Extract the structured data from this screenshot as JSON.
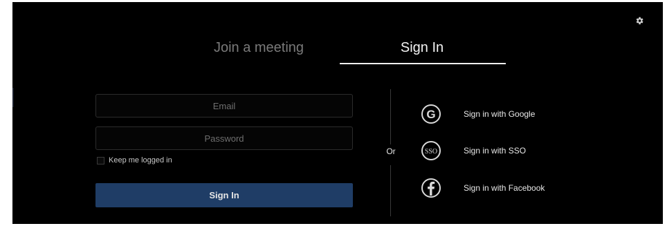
{
  "tabs": [
    {
      "label": "Join a meeting",
      "active": false
    },
    {
      "label": "Sign In",
      "active": true
    }
  ],
  "form": {
    "email_placeholder": "Email",
    "password_placeholder": "Password",
    "keep_logged_in_label": "Keep me logged in",
    "keep_logged_in_checked": false,
    "submit_label": "Sign In"
  },
  "divider_text": "Or",
  "social": [
    {
      "label": "Sign in with Google",
      "icon": "google-icon"
    },
    {
      "label": "Sign in with SSO",
      "icon": "sso-icon",
      "icon_text": "SSO"
    },
    {
      "label": "Sign in with Facebook",
      "icon": "facebook-icon"
    }
  ],
  "colors": {
    "background": "#000000",
    "accent_button": "#1f3d66",
    "active_tab": "#f2f2f2",
    "inactive_tab": "#7a7a7a"
  }
}
